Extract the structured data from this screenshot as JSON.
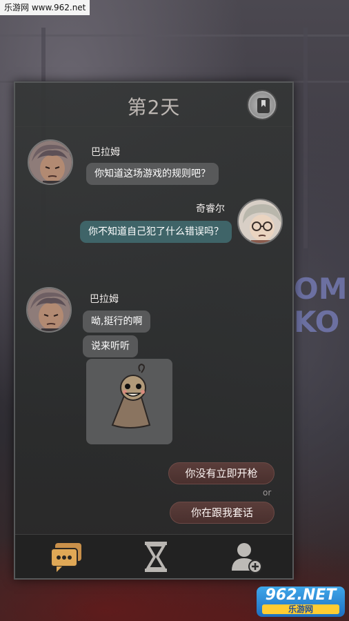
{
  "watermark_top": "乐游网 www.962.net",
  "watermark_bottom": {
    "brand": "962.NET",
    "sub": "乐游网"
  },
  "header": {
    "title": "第2天"
  },
  "messages": [
    {
      "speaker": "巴拉姆",
      "side": "left",
      "text": "你知道这场游戏的规则吧？"
    },
    {
      "speaker": "奇睿尔",
      "side": "right",
      "text": "你不知道自己犯了什么错误吗？"
    },
    {
      "speaker": "巴拉姆",
      "side": "left",
      "lines": [
        "呦,挺行的啊",
        "说来听听"
      ]
    }
  ],
  "choices": {
    "option1": "你没有立即开枪",
    "or": "or",
    "option2": "你在跟我套话"
  },
  "background": {
    "graffiti": "OMI\nKO"
  },
  "nav": {
    "items": [
      {
        "icon": "chat-icon",
        "active": true
      },
      {
        "icon": "hourglass-icon",
        "active": false
      },
      {
        "icon": "add-contact-icon",
        "active": false
      }
    ]
  },
  "colors": {
    "accent": "#d9a54a",
    "bubble_left": "#58595a",
    "bubble_right": "#3f6468",
    "choice": "#5a3d3a"
  }
}
